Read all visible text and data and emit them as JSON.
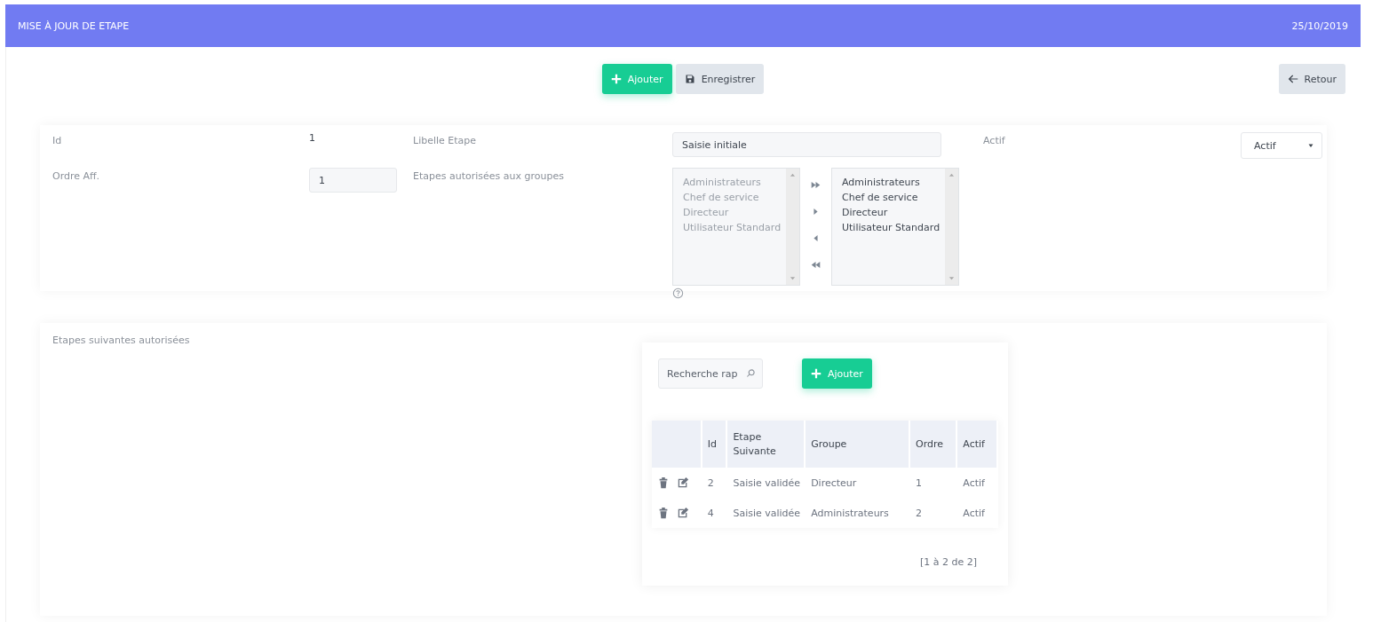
{
  "header": {
    "title": "MISE À JOUR DE ETAPE",
    "date": "25/10/2019"
  },
  "toolbar": [
    {
      "kind": "add",
      "label": "Ajouter"
    },
    {
      "kind": "save",
      "label": "Enregistrer"
    },
    {
      "kind": "back",
      "label": "Retour"
    }
  ],
  "form": {
    "id_label": "Id",
    "id_value": "1",
    "libelle_label": "Libelle Etape",
    "libelle_value": "Saisie initiale",
    "actif_label": "Actif",
    "actif_value": "Actif",
    "ordre_label": "Ordre Aff.",
    "ordre_value": "1",
    "groups_label": "Etapes autorisées aux groupes",
    "lists": [
      {
        "disabled": true,
        "items": [
          "Administrateurs",
          "Chef de service",
          "Directeur",
          "Utilisateur Standard"
        ]
      },
      {
        "disabled": false,
        "items": [
          "Administrateurs",
          "Chef de service",
          "Directeur",
          "Utilisateur Standard"
        ]
      }
    ]
  },
  "next": {
    "label": "Etapes suivantes autorisées",
    "search": {
      "placeholder": "Recherche rap"
    },
    "add_button": "Ajouter",
    "columns": [
      "Id",
      "Etape Suivante",
      "Groupe",
      "Ordre",
      "Actif"
    ],
    "rows": [
      [
        "2",
        "Saisie validée",
        "Directeur",
        "1",
        "Actif"
      ],
      [
        "4",
        "Saisie validée",
        "Administrateurs",
        "2",
        "Actif"
      ]
    ],
    "pagination": "[1 à 2 de 2]"
  }
}
